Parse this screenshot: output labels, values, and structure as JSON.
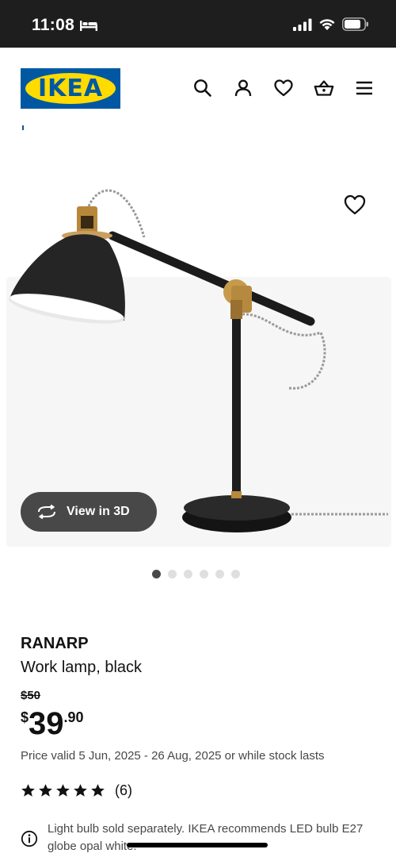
{
  "status_bar": {
    "time": "11:08"
  },
  "header": {
    "logo_text": "IKEA",
    "icons": [
      "search-icon",
      "profile-icon",
      "heart-icon",
      "basket-icon",
      "menu-icon"
    ]
  },
  "gallery": {
    "view_3d_label": "View in 3D",
    "dot_count": 6,
    "active_dot": 1
  },
  "product": {
    "name": "RANARP",
    "description": "Work lamp, black",
    "old_price": "$50",
    "price_currency": "$",
    "price_integer": "39",
    "price_decimal": ".90",
    "validity": "Price valid 5 Jun, 2025 - 26 Aug, 2025 or while stock lasts",
    "rating_stars": 5,
    "review_count": "(6)",
    "notice": "Light bulb sold separately. IKEA recommends LED bulb E27 globe opal white."
  },
  "colors": {
    "brand_blue": "#0058a3",
    "brand_yellow": "#ffdb00",
    "text": "#111111",
    "secondary_text": "#484848"
  }
}
